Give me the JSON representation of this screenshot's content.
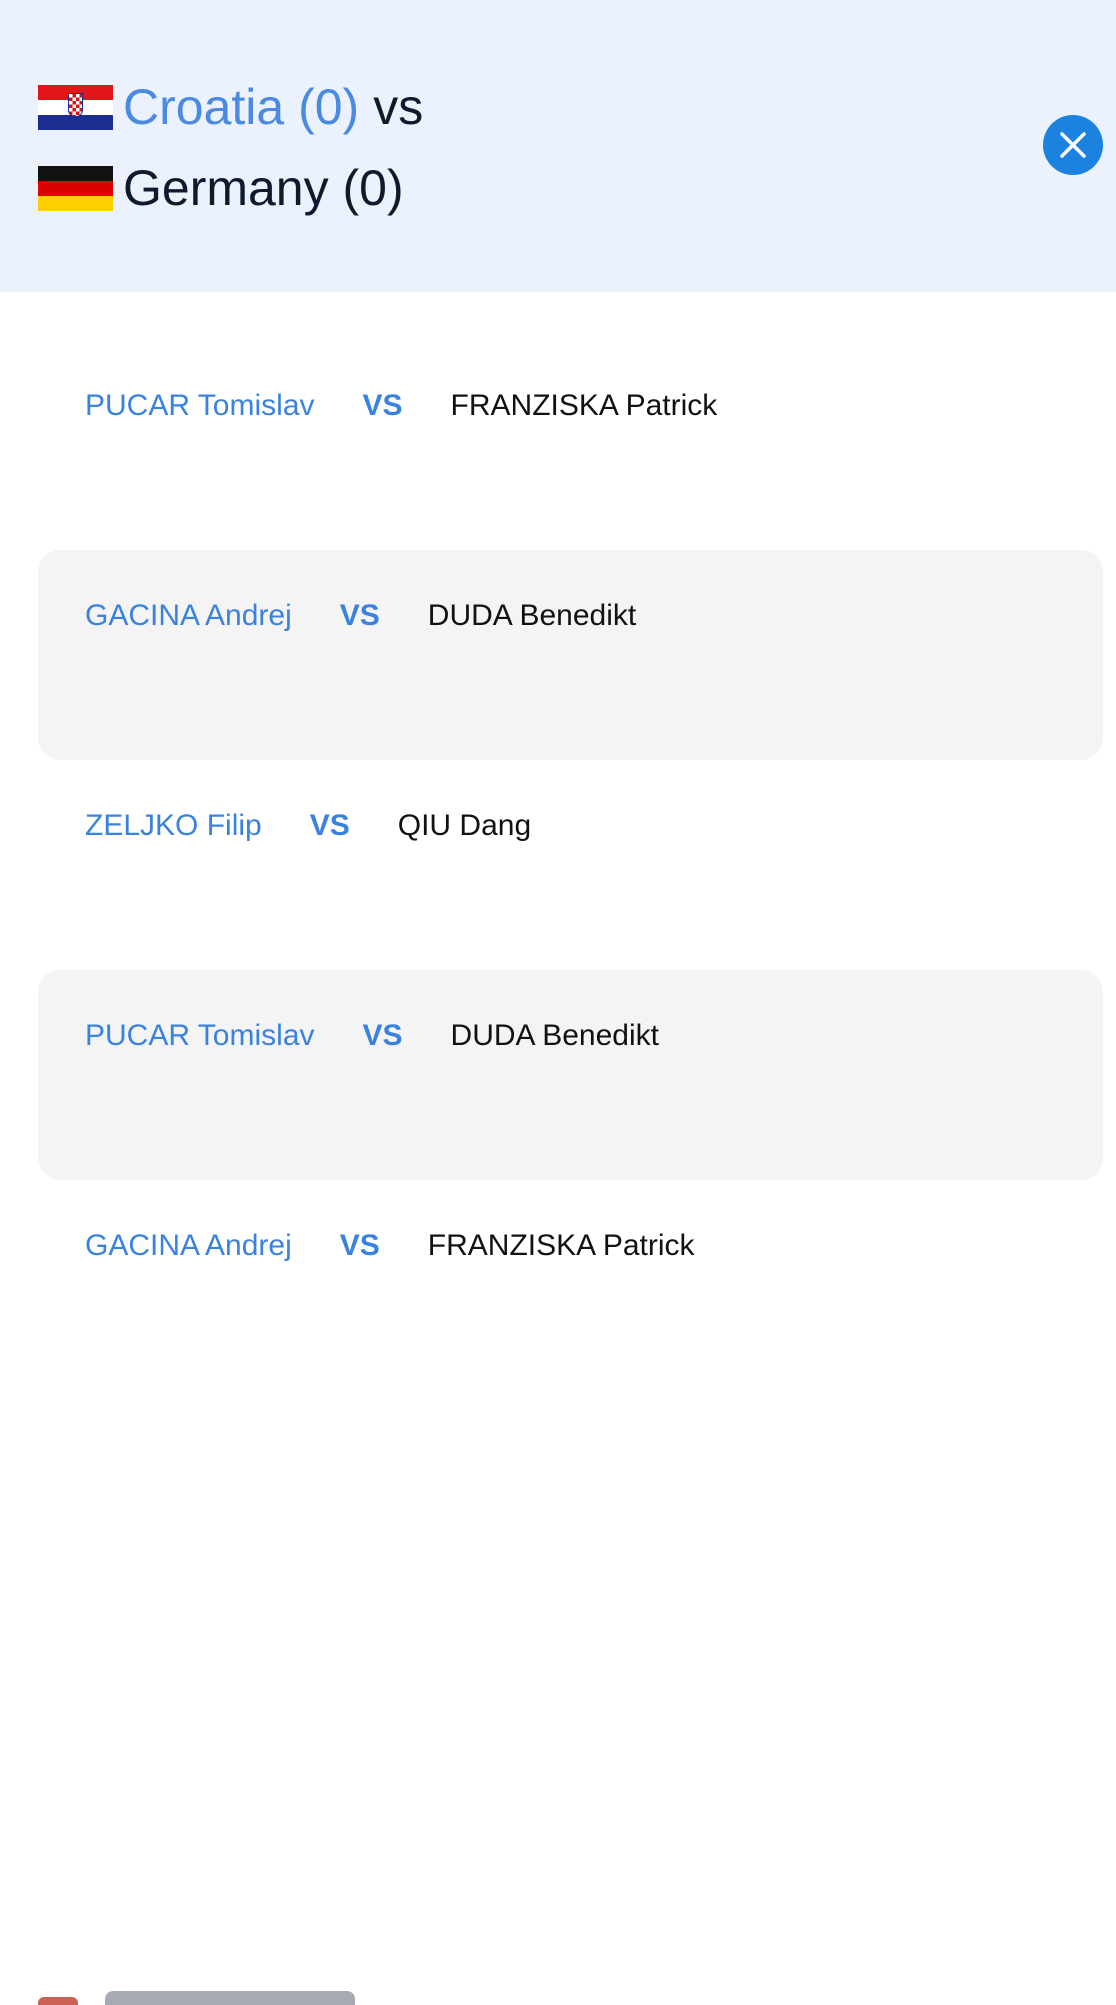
{
  "header": {
    "home_team": {
      "flag": "croatia-flag",
      "name": "Croatia (0)"
    },
    "vs_text": "vs",
    "away_team": {
      "flag": "germany-flag",
      "name": "Germany (0)"
    },
    "close_icon": "close-icon"
  },
  "matches": [
    {
      "home_player": "PUCAR Tomislav",
      "vs_label": "VS",
      "away_player": "FRANZISKA Patrick"
    },
    {
      "home_player": "GACINA Andrej",
      "vs_label": "VS",
      "away_player": "DUDA Benedikt"
    },
    {
      "home_player": "ZELJKO Filip",
      "vs_label": "VS",
      "away_player": "QIU Dang"
    },
    {
      "home_player": "PUCAR Tomislav",
      "vs_label": "VS",
      "away_player": "DUDA Benedikt"
    },
    {
      "home_player": "GACINA Andrej",
      "vs_label": "VS",
      "away_player": "FRANZISKA Patrick"
    }
  ],
  "colors": {
    "header_background": "#ebf2fd",
    "accent_blue": "#3a82e0",
    "close_button": "#1b82df",
    "alt_row_background": "#f4f4f4"
  }
}
